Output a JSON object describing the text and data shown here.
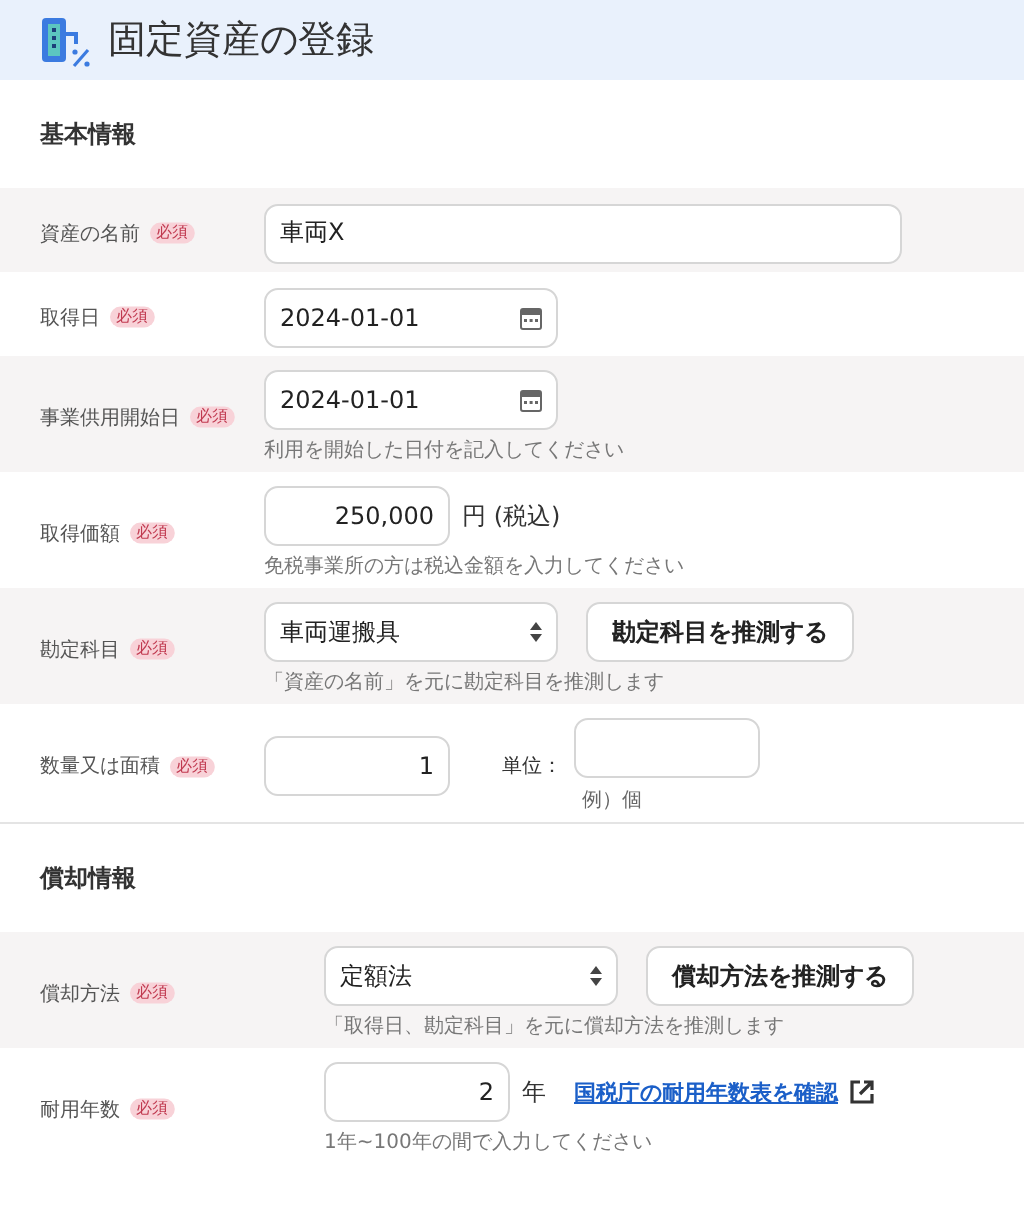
{
  "header": {
    "title": "固定資産の登録"
  },
  "sections": [
    {
      "title": "基本情報",
      "rows": [
        {
          "label": "資産の名前",
          "badge": "必須",
          "kind": "text",
          "value": "車両X"
        },
        {
          "label": "取得日",
          "badge": "必須",
          "kind": "date",
          "value": "2024-01-01"
        },
        {
          "label": "事業供用開始日",
          "badge": "必須",
          "kind": "date",
          "value": "2024-01-01",
          "hint": "利用を開始した日付を記入してください"
        },
        {
          "label": "取得価額",
          "badge": "必須",
          "kind": "amount",
          "value": "250,000",
          "suffix": "円 (税込)",
          "hint": "免税事業所の方は税込金額を入力してください"
        },
        {
          "label": "勘定科目",
          "badge": "必須",
          "kind": "select",
          "value": "車両運搬具",
          "button": "勘定科目を推測する",
          "hint": "「資産の名前」を元に勘定科目を推測します"
        },
        {
          "label": "数量又は面積",
          "badge": "必須",
          "kind": "quantity",
          "value": "1",
          "unit_label": "単位：",
          "unit_hint": "例）個"
        }
      ]
    },
    {
      "title": "償却情報",
      "rows": [
        {
          "label": "償却方法",
          "badge": "必須",
          "kind": "select",
          "value": "定額法",
          "button": "償却方法を推測する",
          "hint": "「取得日、勘定科目」を元に償却方法を推測します"
        },
        {
          "label": "耐用年数",
          "badge": "必須",
          "kind": "years",
          "value": "2",
          "suffix": "年",
          "link": "国税庁の耐用年数表を確認",
          "hint": "1年~100年の間で入力してください"
        }
      ]
    }
  ]
}
